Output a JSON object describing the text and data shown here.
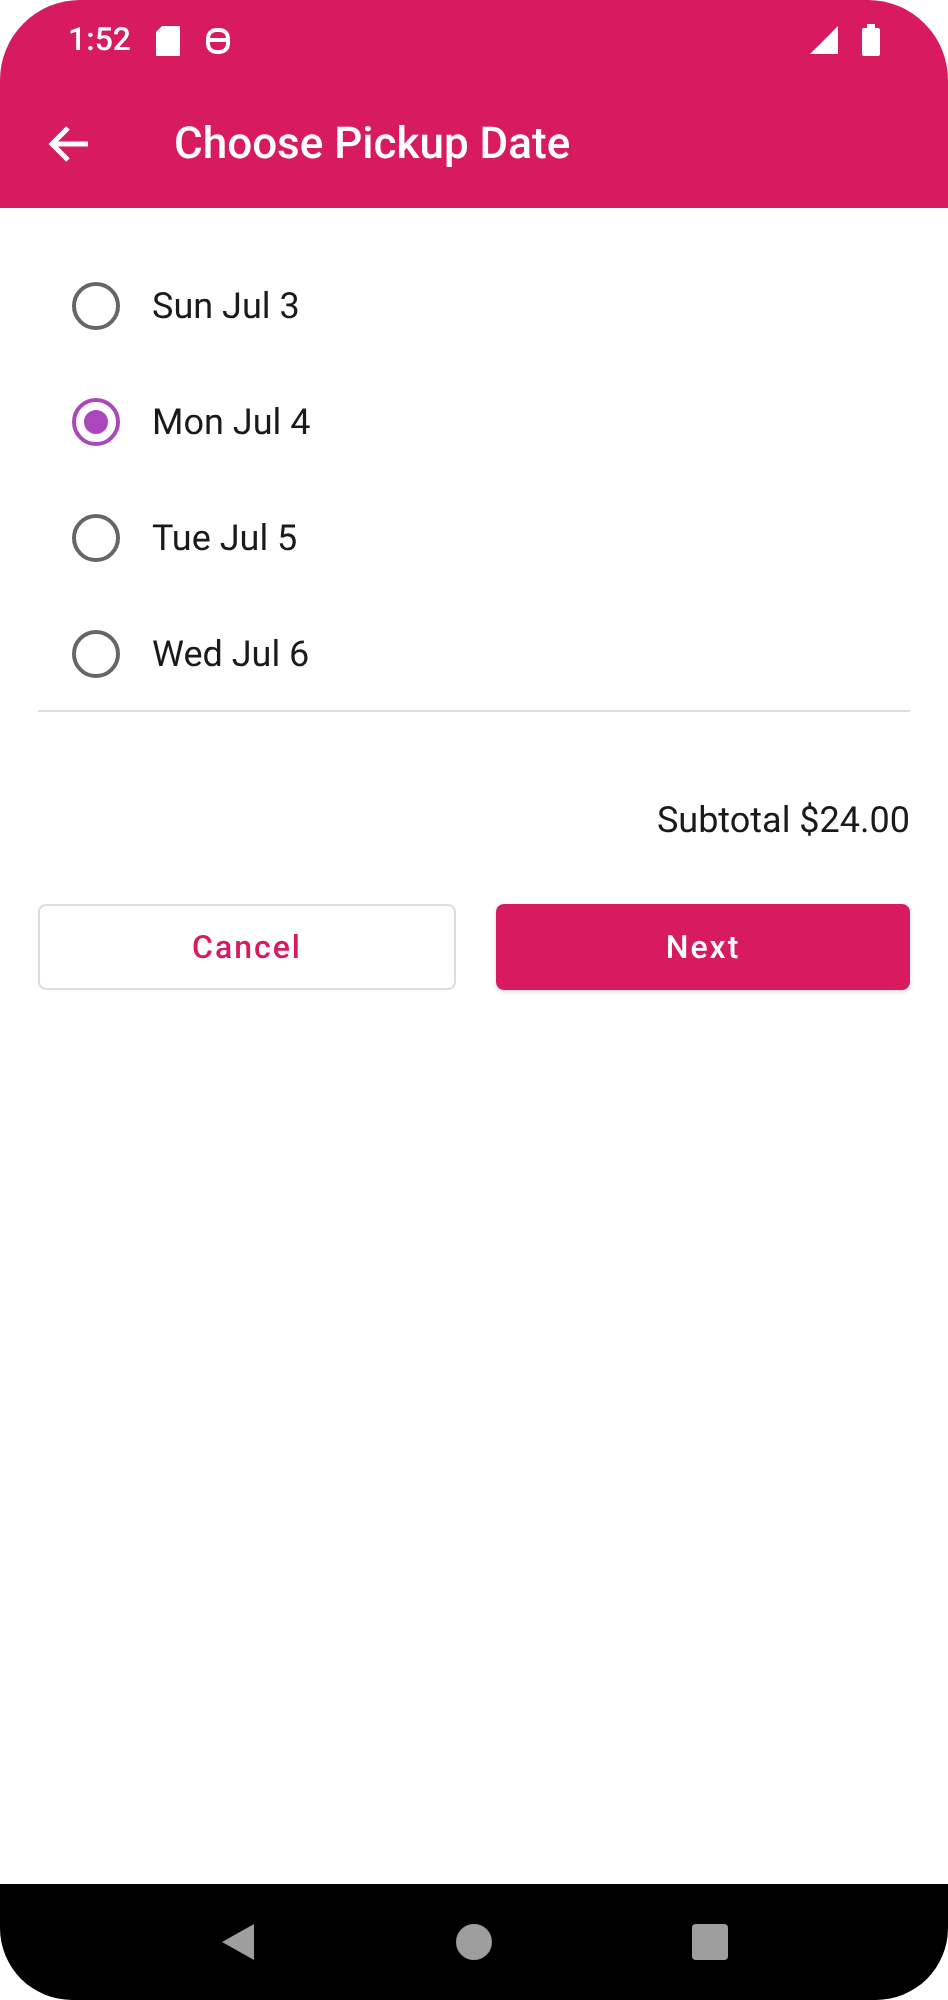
{
  "status_bar": {
    "time": "1:52"
  },
  "app_bar": {
    "title": "Choose Pickup Date"
  },
  "options": [
    {
      "label": "Sun Jul 3",
      "selected": false
    },
    {
      "label": "Mon Jul 4",
      "selected": true
    },
    {
      "label": "Tue Jul 5",
      "selected": false
    },
    {
      "label": "Wed Jul 6",
      "selected": false
    }
  ],
  "subtotal": "Subtotal $24.00",
  "buttons": [
    {
      "kind": "outlined",
      "label": "Cancel"
    },
    {
      "kind": "filled",
      "label": "Next"
    }
  ]
}
